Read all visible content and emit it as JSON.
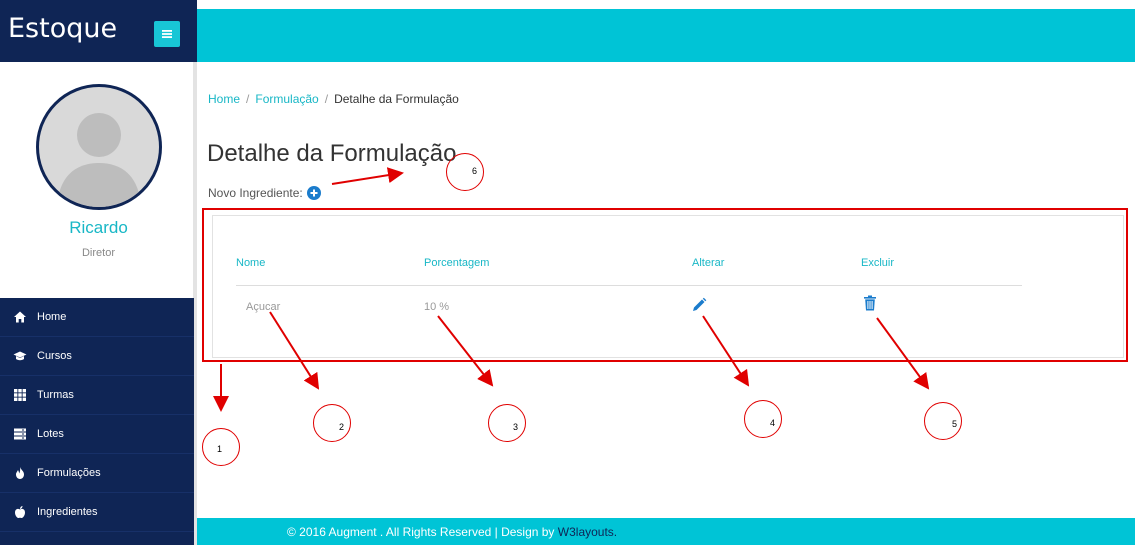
{
  "brand": {
    "title": "Estoque",
    "toggle_icon": "hamburger-icon"
  },
  "profile": {
    "name": "Ricardo",
    "role": "Diretor"
  },
  "nav": [
    {
      "label": "Home",
      "icon": "home-icon"
    },
    {
      "label": "Cursos",
      "icon": "graduation-cap-icon"
    },
    {
      "label": "Turmas",
      "icon": "grid-icon"
    },
    {
      "label": "Lotes",
      "icon": "server-icon"
    },
    {
      "label": "Formulações",
      "icon": "fire-icon"
    },
    {
      "label": "Ingredientes",
      "icon": "apple-icon"
    }
  ],
  "breadcrumb": {
    "home": "Home",
    "section": "Formulação",
    "current": "Detalhe da Formulação",
    "separator": "/"
  },
  "page": {
    "title": "Detalhe da Formulação",
    "new_ingredient_label": "Novo Ingrediente:"
  },
  "table": {
    "headers": {
      "name": "Nome",
      "percent": "Porcentagem",
      "edit": "Alterar",
      "delete": "Excluir"
    },
    "rows": [
      {
        "name": "Açucar",
        "percent": "10 %"
      }
    ]
  },
  "annotations": [
    "1",
    "2",
    "3",
    "4",
    "5",
    "6"
  ],
  "footer": {
    "text": "© 2016 Augment . All Rights Reserved | Design by ",
    "link": "W3layouts."
  },
  "colors": {
    "navy": "#0f2555",
    "cyan": "#00c4d6",
    "accent": "#18b7c6",
    "annotation": "#e00000"
  }
}
